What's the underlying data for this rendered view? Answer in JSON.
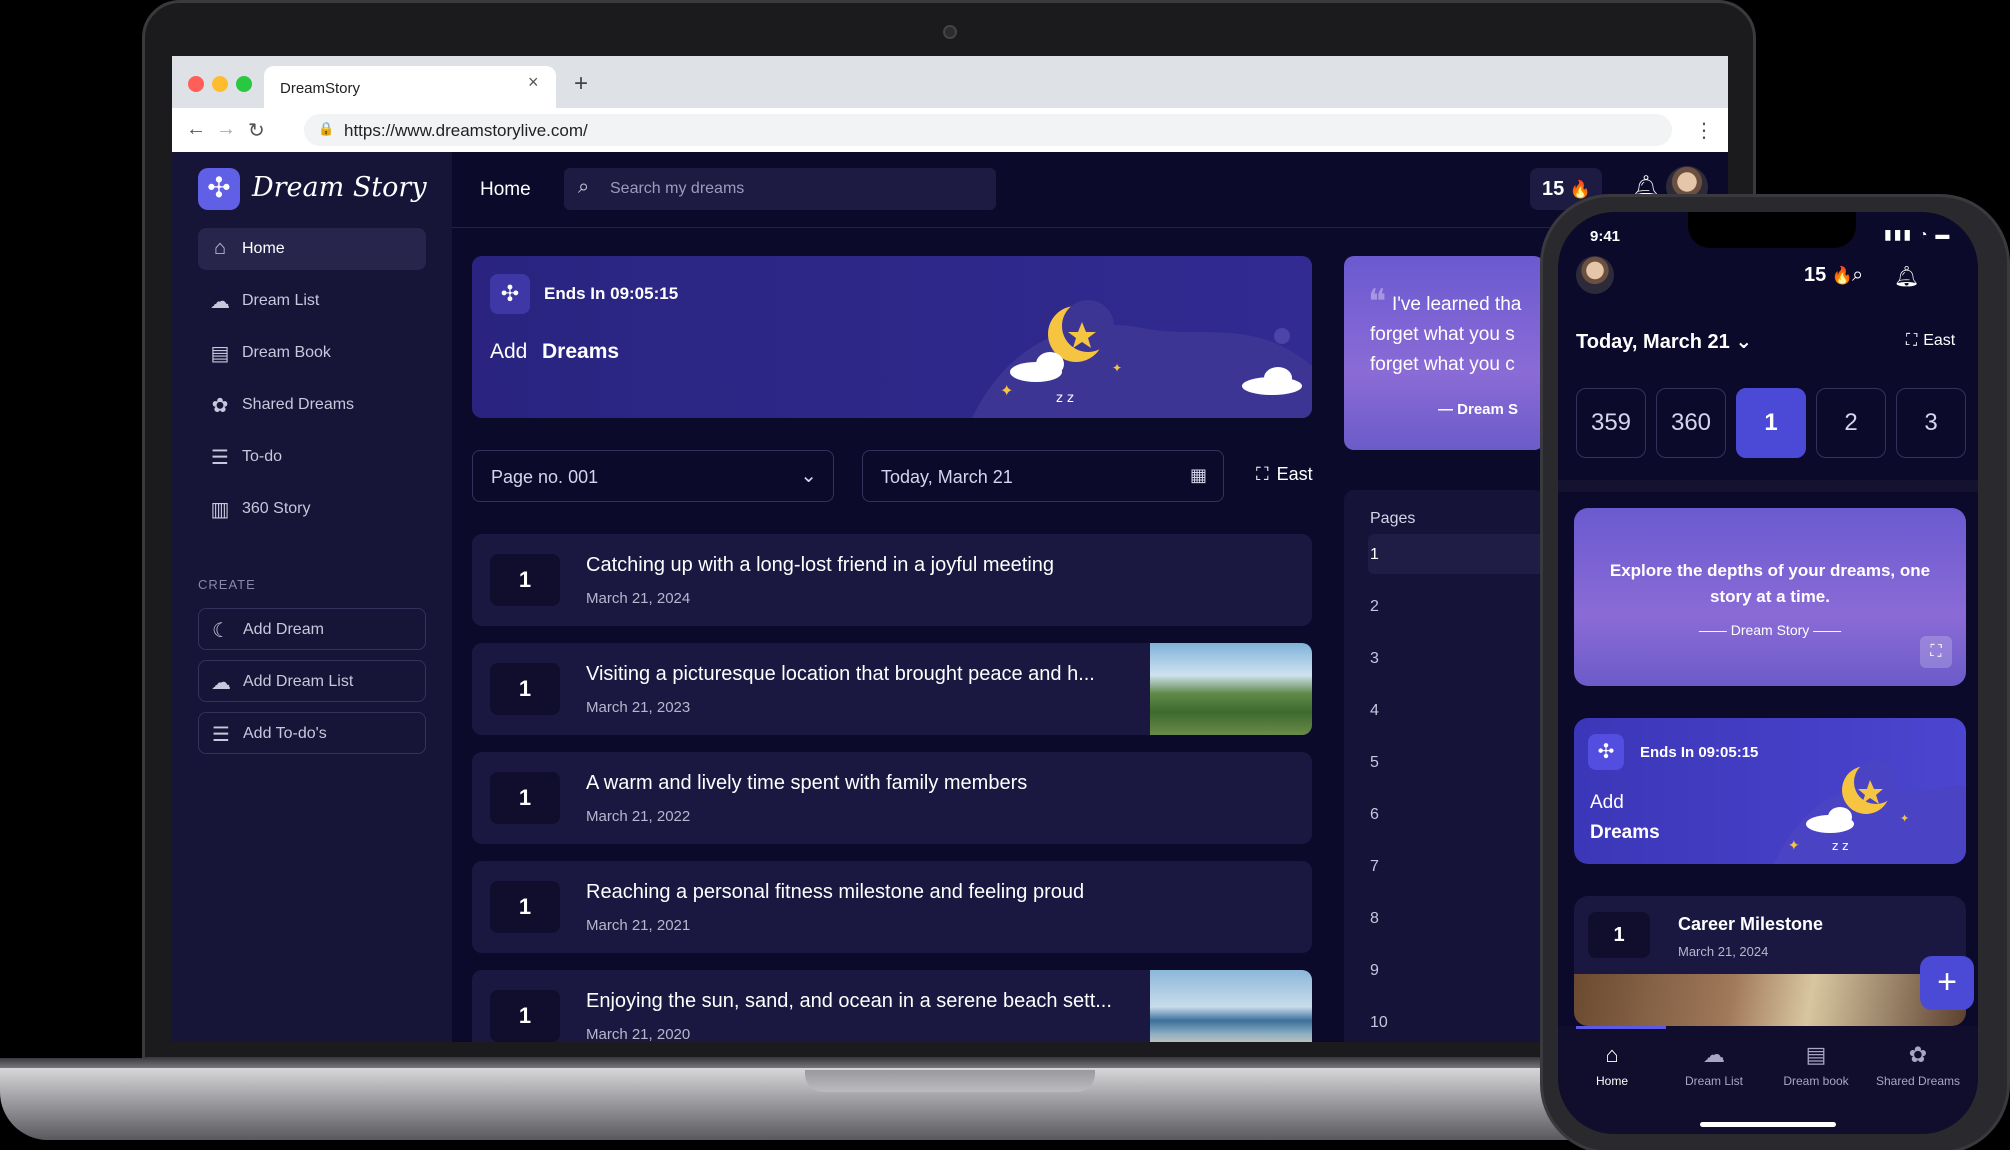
{
  "browser": {
    "tab_title": "DreamStory",
    "tab_close": "×",
    "new_tab": "+",
    "url": "https://www.dreamstorylive.com/",
    "back": "←",
    "forward": "→",
    "reload": "↻",
    "menu": "⋮",
    "traffic_lights": [
      "#ff5f57",
      "#febc2e",
      "#28c840"
    ]
  },
  "brand": {
    "name": "Dream Story",
    "accent": "#5b5ae6"
  },
  "sidebar": {
    "items": [
      {
        "label": "Home",
        "icon": "home-icon",
        "glyph": "⌂",
        "active": true
      },
      {
        "label": "Dream List",
        "icon": "dream-list-icon",
        "glyph": "☁"
      },
      {
        "label": "Dream Book",
        "icon": "book-icon",
        "glyph": "▤"
      },
      {
        "label": "Shared Dreams",
        "icon": "shared-icon",
        "glyph": "✿"
      },
      {
        "label": "To-do",
        "icon": "list-icon",
        "glyph": "☰"
      },
      {
        "label": "360 Story",
        "icon": "story-icon",
        "glyph": "▥"
      }
    ],
    "create_label": "CREATE",
    "create_items": [
      {
        "label": "Add Dream",
        "icon": "moon-icon",
        "glyph": "☾"
      },
      {
        "label": "Add Dream List",
        "icon": "dream-list-icon",
        "glyph": "☁"
      },
      {
        "label": "Add To-do's",
        "icon": "list-icon",
        "glyph": "☰"
      }
    ]
  },
  "topbar": {
    "title": "Home",
    "search_placeholder": "Search my dreams",
    "streak": "15",
    "streak_icon": "🔥"
  },
  "hero": {
    "ends": "Ends In 09:05:15",
    "add": "Add",
    "dreams": "Dreams"
  },
  "quote": {
    "lines": [
      "I've learned tha",
      "forget what you s",
      "forget what you c"
    ],
    "source": "— Dream S"
  },
  "filters": {
    "page": "Page no. 001",
    "date": "Today, March 21",
    "east": "East"
  },
  "dreams": [
    {
      "num": "1",
      "title": "Catching up with a long-lost friend in a joyful meeting",
      "date": "March 21, 2024",
      "image": null
    },
    {
      "num": "1",
      "title": "Visiting a picturesque location that brought peace and h...",
      "date": "March 21, 2023",
      "image": "mountain"
    },
    {
      "num": "1",
      "title": "A warm and lively time spent with family members",
      "date": "March 21, 2022",
      "image": null
    },
    {
      "num": "1",
      "title": "Reaching a personal fitness milestone and feeling proud",
      "date": "March 21, 2021",
      "image": null
    },
    {
      "num": "1",
      "title": "Enjoying the sun, sand, and ocean in a serene beach sett...",
      "date": "March 21, 2020",
      "image": "beach"
    }
  ],
  "pages": {
    "label": "Pages",
    "items": [
      "1",
      "2",
      "3",
      "4",
      "5",
      "6",
      "7",
      "8",
      "9",
      "10"
    ],
    "active": "1"
  },
  "phone": {
    "time": "9:41",
    "status": "▮▮▮ ◔ ▬",
    "streak": "15",
    "date": "Today, March 21",
    "east": "East",
    "days": [
      {
        "label": "359",
        "active": false
      },
      {
        "label": "360",
        "active": false
      },
      {
        "label": "1",
        "active": true
      },
      {
        "label": "2",
        "active": false
      },
      {
        "label": "3",
        "active": false
      }
    ],
    "quote": "Explore the depths of your dreams, one story at a time.",
    "quote_source": "—— Dream Story ——",
    "hero_ends": "Ends In 09:05:15",
    "hero_add": "Add",
    "hero_dreams": "Dreams",
    "card_num": "1",
    "card_title": "Career Milestone",
    "card_date": "March 21, 2024",
    "fab": "+",
    "tabs": [
      {
        "label": "Home",
        "icon": "home-icon",
        "glyph": "⌂",
        "active": true
      },
      {
        "label": "Dream List",
        "icon": "dream-list-icon",
        "glyph": "☁"
      },
      {
        "label": "Dream book",
        "icon": "book-icon",
        "glyph": "▤"
      },
      {
        "label": "Shared Dreams",
        "icon": "shared-icon",
        "glyph": "✿"
      }
    ]
  }
}
